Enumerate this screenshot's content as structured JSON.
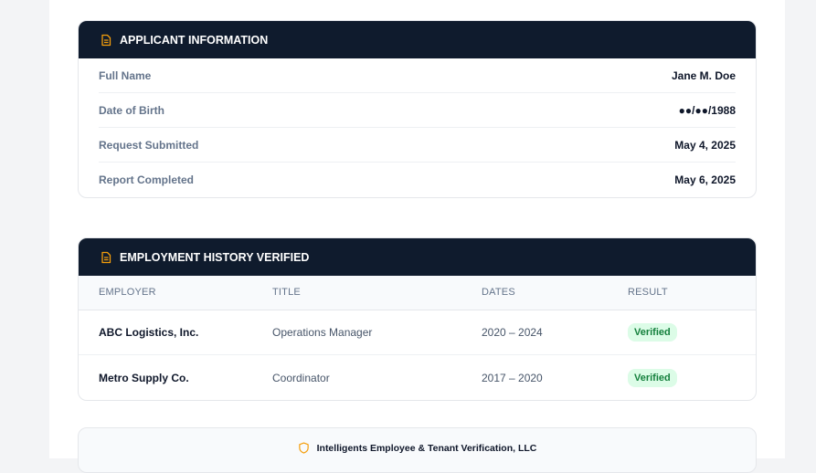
{
  "applicant": {
    "header": "APPLICANT INFORMATION",
    "rows": [
      {
        "label": "Full Name",
        "value": "Jane M. Doe"
      },
      {
        "label": "Date of Birth",
        "value": "●●/●●/1988"
      },
      {
        "label": "Request Submitted",
        "value": "May 4, 2025"
      },
      {
        "label": "Report Completed",
        "value": "May 6, 2025"
      }
    ]
  },
  "employment": {
    "header": "EMPLOYMENT HISTORY VERIFIED",
    "columns": [
      "EMPLOYER",
      "TITLE",
      "DATES",
      "RESULT"
    ],
    "rows": [
      {
        "employer": "ABC Logistics, Inc.",
        "title": "Operations Manager",
        "dates": "2020 – 2024",
        "result": "Verified"
      },
      {
        "employer": "Metro Supply Co.",
        "title": "Coordinator",
        "dates": "2017 – 2020",
        "result": "Verified"
      }
    ]
  },
  "footer": {
    "company": "Intelligents Employee & Tenant Verification, LLC"
  },
  "colors": {
    "header_bg": "#0f1b2d",
    "accent": "#f59e0b",
    "verified_bg": "#dcfce7",
    "verified_text": "#15803d"
  },
  "icons": {
    "section_header": "document-icon",
    "footer": "shield-icon"
  }
}
